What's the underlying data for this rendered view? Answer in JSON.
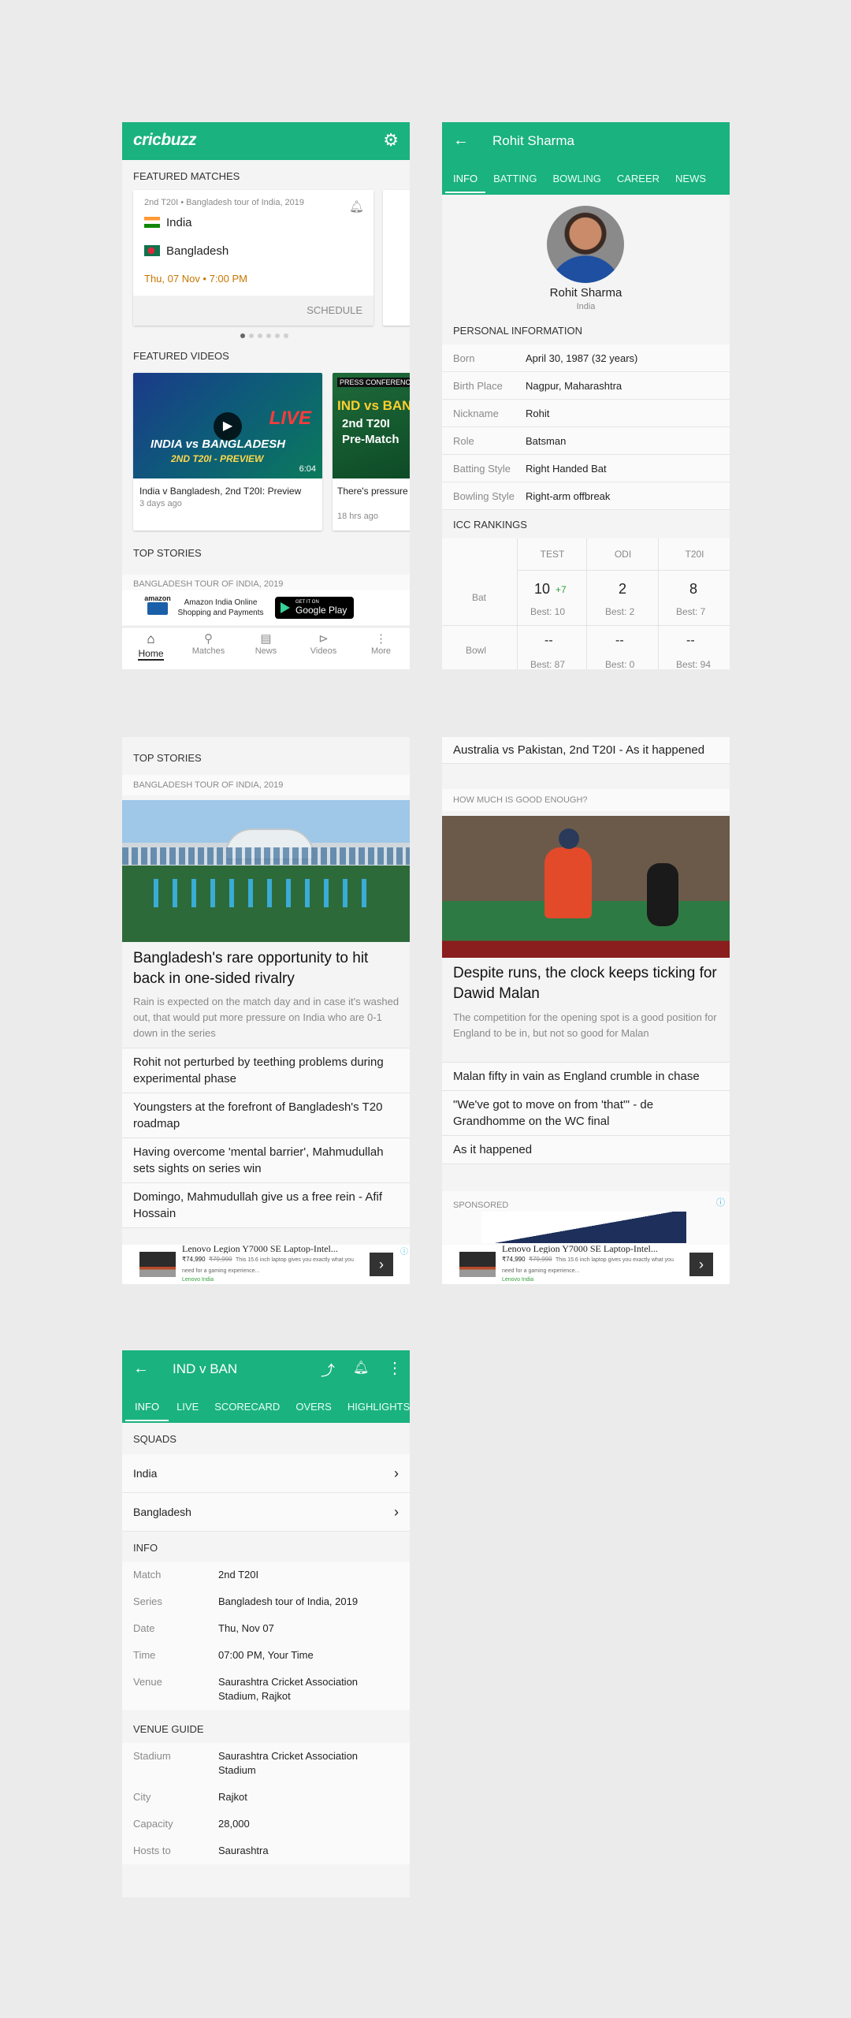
{
  "s1": {
    "brand": "cricbuzz",
    "featured_matches": "FEATURED MATCHES",
    "match": {
      "meta": "2nd T20I • Bangladesh tour of India, 2019",
      "team1": "India",
      "team2": "Bangladesh",
      "time": "Thu, 07 Nov • 7:00 PM",
      "schedule": "SCHEDULE"
    },
    "featured_videos": "FEATURED VIDEOS",
    "video1": {
      "title": "India v Bangladesh, 2nd T20I: Preview",
      "age": "3 days ago",
      "duration": "6:04",
      "thumb_line1": "INDIA vs BANGLADESH",
      "thumb_line2": "2ND T20I - PREVIEW",
      "thumb_badge": "LIVE"
    },
    "video2": {
      "title": "There's pressure to perform - Rohit S",
      "age": "18 hrs ago",
      "thumb_tag": "PRESS CONFERENCE",
      "thumb_line1": "IND vs BAN",
      "thumb_line2": "2nd T20I",
      "thumb_line3": "Pre-Match"
    },
    "top_stories": "TOP STORIES",
    "tour_label": "BANGLADESH TOUR OF INDIA, 2019",
    "ad": {
      "brand": "amazon",
      "text": "Amazon India Online Shopping and Payments",
      "store_top": "GET IT ON",
      "store": "Google Play"
    },
    "nav": [
      "Home",
      "Matches",
      "News",
      "Videos",
      "More"
    ]
  },
  "s2": {
    "title": "Rohit Sharma",
    "tabs": [
      "INFO",
      "BATTING",
      "BOWLING",
      "CAREER",
      "NEWS"
    ],
    "name": "Rohit Sharma",
    "country": "India",
    "personal": "PERSONAL INFORMATION",
    "rows": [
      {
        "k": "Born",
        "v": "April 30, 1987 (32 years)"
      },
      {
        "k": "Birth Place",
        "v": "Nagpur, Maharashtra"
      },
      {
        "k": "Nickname",
        "v": "Rohit"
      },
      {
        "k": "Role",
        "v": "Batsman"
      },
      {
        "k": "Batting Style",
        "v": "Right Handed Bat"
      },
      {
        "k": "Bowling Style",
        "v": "Right-arm offbreak"
      }
    ],
    "icc": "ICC RANKINGS",
    "cols": [
      "TEST",
      "ODI",
      "T20I"
    ],
    "bat": {
      "label": "Bat",
      "test": "10",
      "test_delta": "+7",
      "odi": "2",
      "t20": "8",
      "test_best": "Best: 10",
      "odi_best": "Best: 2",
      "t20_best": "Best: 7"
    },
    "bowl": {
      "label": "Bowl",
      "test": "--",
      "odi": "--",
      "t20": "--",
      "test_best": "Best: 87",
      "odi_best": "Best: 0",
      "t20_best": "Best: 94"
    }
  },
  "s3": {
    "top_stories": "TOP STORIES",
    "tour_label": "BANGLADESH TOUR OF INDIA, 2019",
    "headline": "Bangladesh's rare opportunity to hit back in one-sided rivalry",
    "summary": "Rain is expected on the match day and in case it's washed out, that would put more pressure on India who are 0-1 down in the series",
    "stories": [
      "Rohit not perturbed by teething problems during experimental phase",
      "Youngsters at the forefront of Bangladesh's T20 roadmap",
      "Having overcome 'mental barrier', Mahmudullah sets sights on series win",
      "Domingo, Mahmudullah give us a free rein - Afif Hossain"
    ],
    "ad_title": "Lenovo Legion Y7000 SE Laptop-Intel...",
    "ad_price": "₹74,990",
    "ad_old": "₹79,990",
    "ad_desc": "This 15.6 inch laptop gives you exactly what you need for a gaming experience...",
    "ad_source": "Lenovo India"
  },
  "s4": {
    "top_story": "Australia vs Pakistan, 2nd T20I - As it happened",
    "tag": "HOW MUCH IS GOOD ENOUGH?",
    "headline": "Despite runs, the clock keeps ticking for Dawid Malan",
    "summary": "The competition for the opening spot is a good position for England to be in, but not so good for Malan",
    "stories": [
      "Malan fifty in vain as England crumble in chase",
      "\"We've got to move on from 'that'\" - de Grandhomme on the WC final",
      "As it happened"
    ],
    "sponsored": "SPONSORED",
    "ad_title": "Lenovo Legion Y7000 SE Laptop-Intel...",
    "ad_price": "₹74,990",
    "ad_old": "₹79,990",
    "ad_desc": "This 15.6 inch laptop gives you exactly what you need for a gaming experience...",
    "ad_source": "Lenovo India"
  },
  "s5": {
    "title": "IND v BAN",
    "tabs": [
      "INFO",
      "LIVE",
      "SCORECARD",
      "OVERS",
      "HIGHLIGHTS"
    ],
    "squads": "SQUADS",
    "squad_rows": [
      "India",
      "Bangladesh"
    ],
    "info": "INFO",
    "info_rows": [
      {
        "k": "Match",
        "v": "2nd T20I"
      },
      {
        "k": "Series",
        "v": "Bangladesh tour of India, 2019"
      },
      {
        "k": "Date",
        "v": "Thu, Nov 07"
      },
      {
        "k": "Time",
        "v": "07:00 PM, Your Time"
      },
      {
        "k": "Venue",
        "v": "Saurashtra Cricket Association Stadium, Rajkot"
      }
    ],
    "venue_guide": "VENUE GUIDE",
    "venue_rows": [
      {
        "k": "Stadium",
        "v": "Saurashtra Cricket Association Stadium"
      },
      {
        "k": "City",
        "v": "Rajkot"
      },
      {
        "k": "Capacity",
        "v": "28,000"
      },
      {
        "k": "Hosts to",
        "v": "Saurashtra"
      }
    ]
  },
  "colors": {
    "brand_green": "#1ab27f",
    "time_orange": "#c77700",
    "delta_green": "#2e9e3a"
  }
}
